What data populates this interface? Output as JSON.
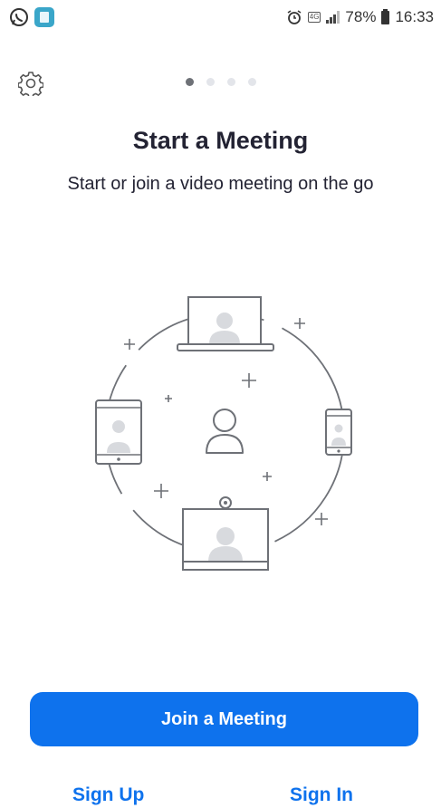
{
  "status_bar": {
    "battery": "78%",
    "time": "16:33",
    "network": "4G"
  },
  "pager": {
    "count": 4,
    "active": 0
  },
  "onboarding": {
    "title": "Start a Meeting",
    "subtitle": "Start or join a video meeting on the go"
  },
  "actions": {
    "join_label": "Join a Meeting",
    "sign_up_label": "Sign Up",
    "sign_in_label": "Sign In"
  },
  "colors": {
    "primary": "#0e72ed",
    "illustration_stroke": "#6e7177",
    "placeholder_fill": "#d8dade"
  }
}
